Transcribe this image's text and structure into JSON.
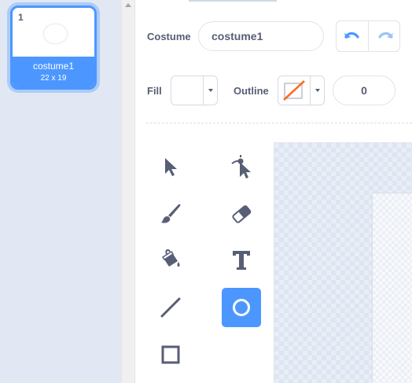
{
  "costume_list": {
    "costumes": [
      {
        "number": "1",
        "name": "costume1",
        "size": "22 x 19",
        "selected": true
      }
    ]
  },
  "editor": {
    "costume_label": "Costume",
    "costume_name": "costume1",
    "fill_label": "Fill",
    "outline_label": "Outline",
    "outline_width": "0",
    "fill_color": "#ffffff",
    "outline_color": "none",
    "undo_icon": "undo-icon",
    "redo_icon": "redo-icon"
  },
  "tools": [
    {
      "name": "select",
      "icon": "select-arrow-icon",
      "active": false
    },
    {
      "name": "reshape",
      "icon": "reshape-icon",
      "active": false
    },
    {
      "name": "brush",
      "icon": "brush-icon",
      "active": false
    },
    {
      "name": "eraser",
      "icon": "eraser-icon",
      "active": false
    },
    {
      "name": "fill",
      "icon": "fill-bucket-icon",
      "active": false
    },
    {
      "name": "text",
      "icon": "text-icon",
      "active": false
    },
    {
      "name": "line",
      "icon": "line-icon",
      "active": false
    },
    {
      "name": "circle",
      "icon": "circle-icon",
      "active": true
    },
    {
      "name": "rectangle",
      "icon": "rectangle-icon",
      "active": false
    }
  ],
  "colors": {
    "accent": "#4c97ff",
    "text": "#575e75",
    "outline_slash": "#ff6b1a",
    "panel_bg": "#e1e8f3"
  }
}
